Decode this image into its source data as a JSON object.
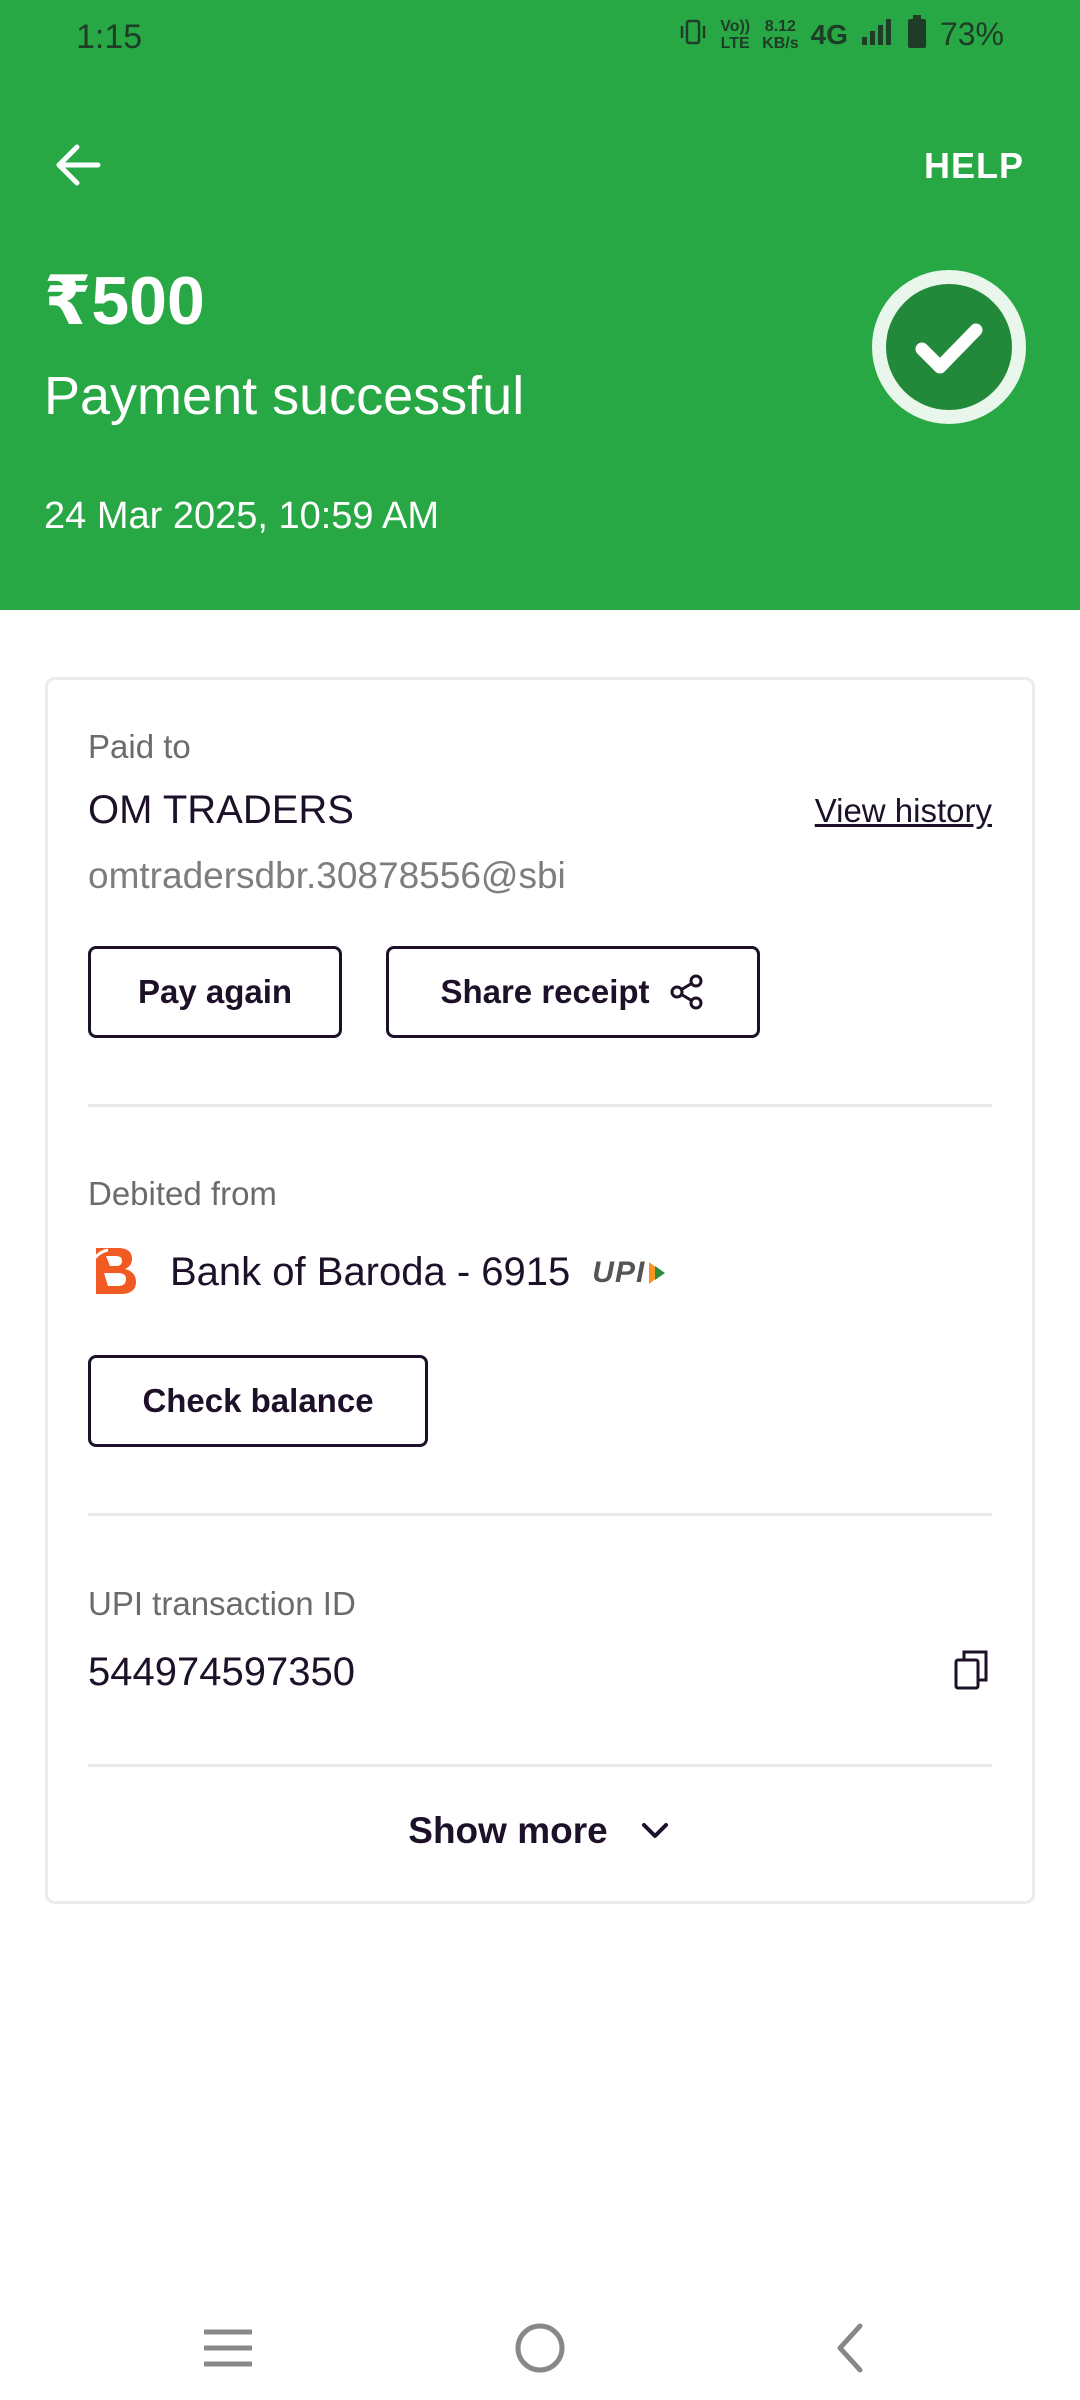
{
  "status_bar": {
    "time": "1:15",
    "volte_top": "Vo))",
    "volte_bottom": "LTE",
    "speed_top": "8.12",
    "speed_bottom": "KB/s",
    "network": "4G",
    "battery": "73%"
  },
  "header": {
    "help_label": "HELP",
    "amount": "₹500",
    "status": "Payment successful",
    "datetime": "24 Mar 2025, 10:59 AM",
    "color": "#27a844"
  },
  "paid_to": {
    "label": "Paid to",
    "name": "OM TRADERS",
    "upi_id": "omtradersdbr.30878556@sbi",
    "view_history": "View history",
    "pay_again": "Pay again",
    "share_receipt": "Share receipt"
  },
  "debited_from": {
    "label": "Debited from",
    "bank": "Bank of Baroda - 6915",
    "upi_logo_text": "UPI",
    "check_balance": "Check balance"
  },
  "transaction": {
    "label": "UPI transaction ID",
    "id": "544974597350"
  },
  "show_more": "Show more",
  "icons": {
    "back": "arrow-left-icon",
    "success": "check-circle-icon",
    "share": "share-icon",
    "copy": "copy-icon",
    "chevron": "chevron-down-icon",
    "bank_logo": "bank-of-baroda-logo",
    "nav_menu": "menu-icon",
    "nav_home": "home-circle-icon",
    "nav_back": "back-chevron-icon"
  }
}
